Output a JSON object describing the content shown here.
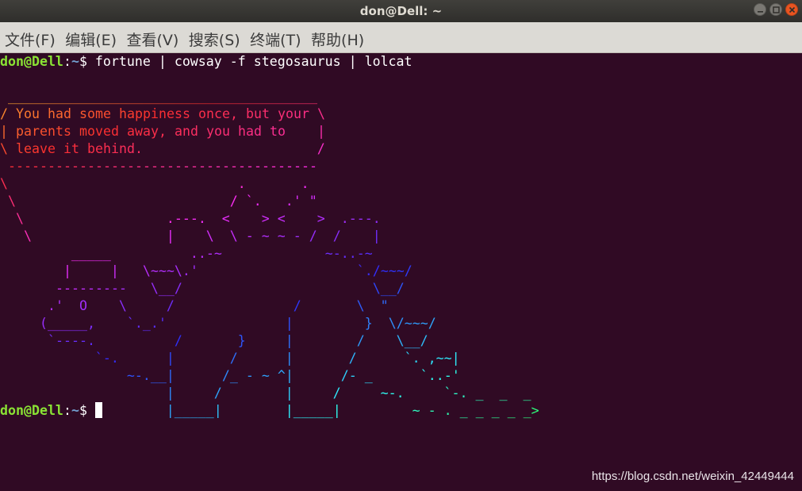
{
  "window": {
    "title": "don@Dell: ~"
  },
  "menu": [
    "文件(F)",
    "编辑(E)",
    "查看(V)",
    "搜索(S)",
    "终端(T)",
    "帮助(H)"
  ],
  "prompt": {
    "userhost": "don@Dell",
    "colon": ":",
    "path": "~",
    "symbol": "$ "
  },
  "command": "fortune | cowsay -f stegosaurus | lolcat",
  "output": [
    " _______________________________________",
    "/ You had some happiness once, but your \\",
    "| parents moved away, and you had to    |",
    "\\ leave it behind.                      /",
    " ---------------------------------------",
    "\\                             .       .",
    " \\                           / `.   .' \"",
    "  \\                  .---.  <    > <    >  .---.",
    "   \\                 |    \\  \\ - ~ ~ - /  /    |",
    "         _____          ..-~             ~-..-~",
    "        |     |   \\~~~\\.'                    `./~~~/",
    "       ---------   \\__/                        \\__/",
    "      .'  O    \\     /               /       \\  \"",
    "     (_____,    `._.'               |         }  \\/~~~/",
    "      `----.          /       }     |        /    \\__/",
    "            `-.      |       /      |       /      `. ,~~|",
    "                ~-.__|      /_ - ~ ^|      /- _      `..-'",
    "                     |     /        |     /     ~-.     `-. _  _  _",
    "                     |_____|        |_____|         ~ - . _ _ _ _ _>"
  ],
  "watermark": "https://blog.csdn.net/weixin_42449444",
  "colors": {
    "terminal_bg": "#300a24",
    "prompt_userhost": "#8ae234",
    "prompt_path": "#729fcf",
    "titlebar": "#3c3b37",
    "menubar": "#dcdad5"
  }
}
